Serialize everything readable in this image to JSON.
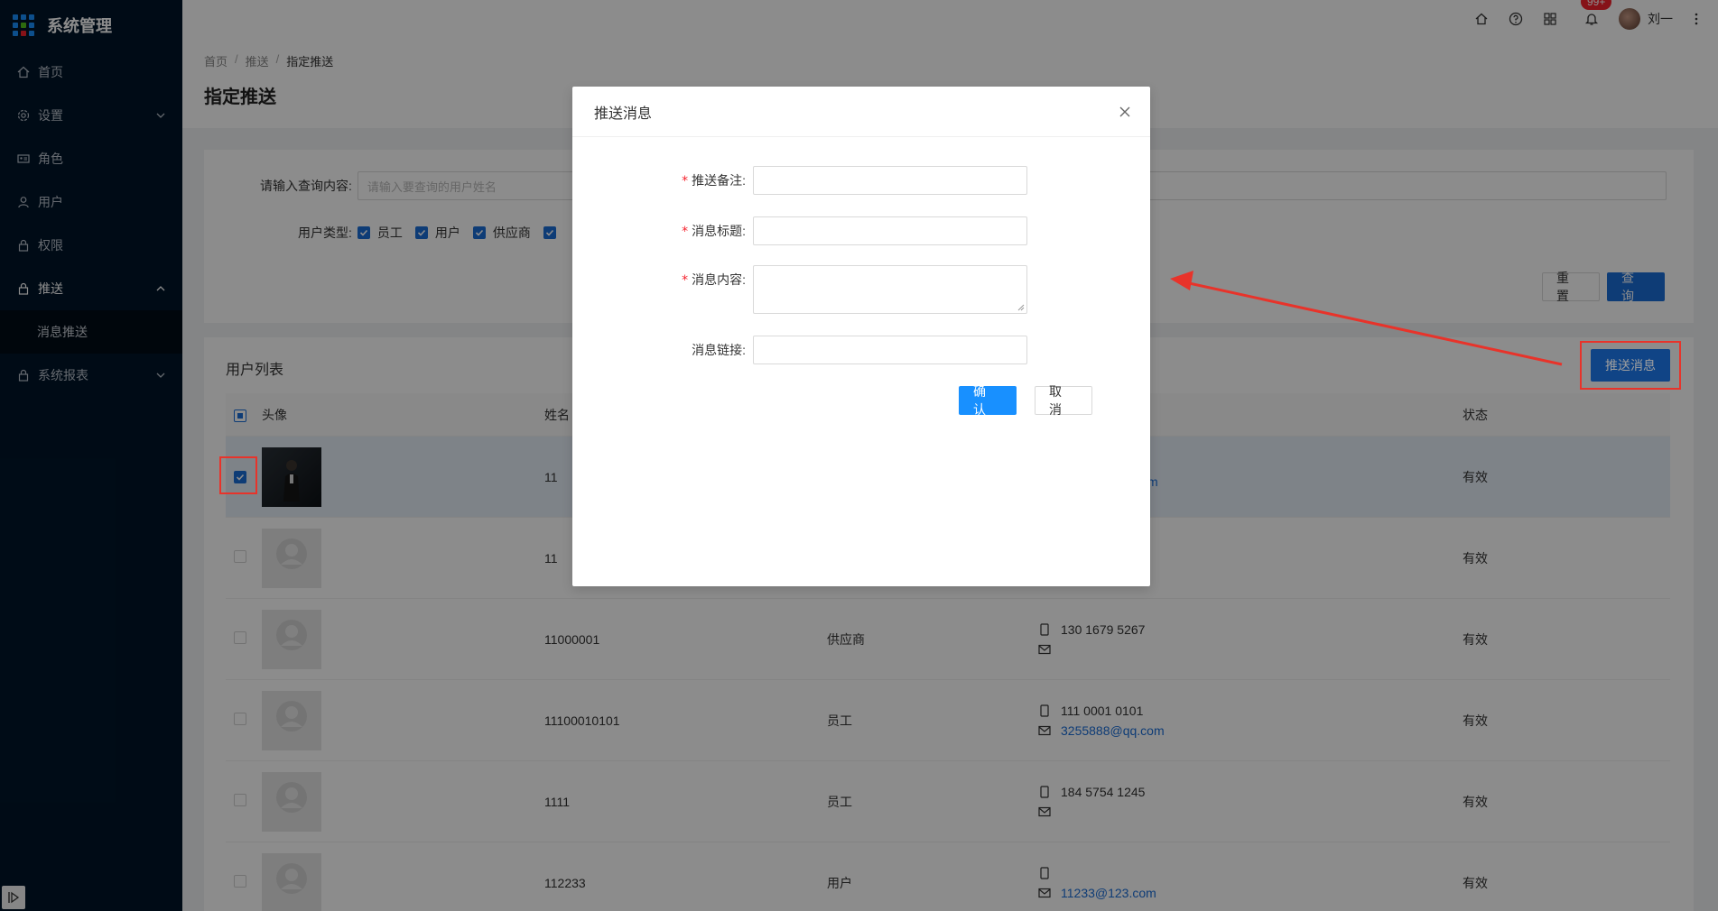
{
  "app": {
    "title": "系统管理"
  },
  "sidebar": {
    "items": [
      {
        "label": "首页",
        "icon": "home-icon"
      },
      {
        "label": "设置",
        "icon": "gear-icon"
      },
      {
        "label": "角色",
        "icon": "id-card-icon"
      },
      {
        "label": "用户",
        "icon": "user-icon"
      },
      {
        "label": "权限",
        "icon": "lock-icon"
      },
      {
        "label": "推送",
        "icon": "lock-icon"
      },
      {
        "label": "系统报表",
        "icon": "lock-icon"
      }
    ],
    "sub_items": [
      {
        "label": "消息推送"
      }
    ]
  },
  "header": {
    "notif_badge": "99+",
    "user_name": "刘一"
  },
  "breadcrumb": {
    "items": [
      "首页",
      "推送",
      "指定推送"
    ],
    "sep": "/"
  },
  "page": {
    "title": "指定推送"
  },
  "search": {
    "query_label": "请输入查询内容:",
    "query_placeholder": "请输入要查询的用户姓名",
    "type_label": "用户类型:",
    "types": [
      "员工",
      "用户",
      "供应商"
    ],
    "reset_label": "重 置",
    "submit_label": "查 询"
  },
  "list": {
    "title": "用户列表",
    "push_button": "推送消息",
    "columns": {
      "avatar": "头像",
      "name": "姓名",
      "status": "状态"
    },
    "rows": [
      {
        "name": "11",
        "type": "",
        "phone": "",
        "email": "m",
        "status": "有效"
      },
      {
        "name": "11",
        "type": "",
        "phone": "",
        "email": "",
        "status": "有效"
      },
      {
        "name": "11000001",
        "type": "供应商",
        "phone": "130 1679 5267",
        "email": "",
        "status": "有效"
      },
      {
        "name": "11100010101",
        "type": "员工",
        "phone": "111 0001 0101",
        "email": "3255888@qq.com",
        "status": "有效"
      },
      {
        "name": "1111",
        "type": "员工",
        "phone": "184 5754 1245",
        "email": "",
        "status": "有效"
      },
      {
        "name": "112233",
        "type": "用户",
        "phone": "",
        "email": "11233@123.com",
        "status": "有效"
      }
    ]
  },
  "modal": {
    "title": "推送消息",
    "fields": {
      "remark": "推送备注:",
      "title": "消息标题:",
      "content": "消息内容:",
      "link": "消息链接:"
    },
    "required_mark": "*",
    "ok_label": "确 认",
    "cancel_label": "取 消"
  },
  "colors": {
    "primary": "#1a6dd8",
    "sidebar_bg": "#001529",
    "annotation": "#e8332a",
    "modal_ok": "#1890ff"
  }
}
